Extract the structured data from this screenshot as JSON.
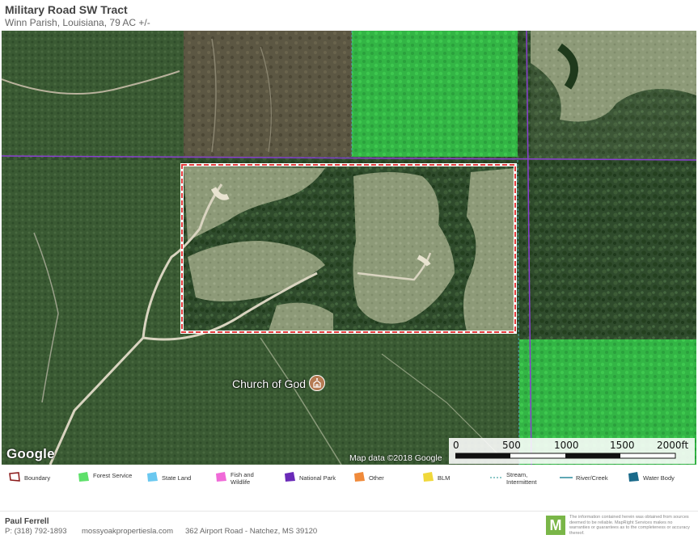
{
  "header": {
    "title": "Military Road SW Tract",
    "subtitle": "Winn Parish, Louisiana, 79 AC +/-"
  },
  "map": {
    "type": "satellite",
    "poi": {
      "label": "Church of God",
      "icon": "church-icon"
    },
    "google_logo": "Google",
    "attribution": "Map data ©2018 Google",
    "scale": {
      "ticks": [
        "0",
        "500",
        "1000",
        "1500",
        "2000ft"
      ]
    },
    "colors": {
      "boundary": "#e23b3b",
      "forest_service": "#39d44a",
      "grid_line": "#8a3fd1"
    }
  },
  "legend": [
    {
      "label": "Boundary",
      "icon": "boundary-outline-icon",
      "color": "#8b1a1a"
    },
    {
      "label": "Forest Service",
      "icon": "polygon-icon",
      "color": "#5ee06a"
    },
    {
      "label": "State Land",
      "icon": "polygon-icon",
      "color": "#6ac8f0"
    },
    {
      "label": "Fish and Wildlife",
      "icon": "polygon-icon",
      "color": "#f06ad8"
    },
    {
      "label": "National Park",
      "icon": "polygon-icon",
      "color": "#6a2ab8"
    },
    {
      "label": "Other",
      "icon": "polygon-icon",
      "color": "#f08a3a"
    },
    {
      "label": "BLM",
      "icon": "polygon-icon",
      "color": "#f0d83a"
    },
    {
      "label": "Stream, Intermittent",
      "icon": "dashed-line-icon",
      "color": "#4aa8a8"
    },
    {
      "label": "River/Creek",
      "icon": "line-icon",
      "color": "#2a8a9a"
    },
    {
      "label": "Water Body",
      "icon": "polygon-icon",
      "color": "#1a6a8a"
    }
  ],
  "footer": {
    "name": "Paul Ferrell",
    "phone": "P: (318) 792-1893",
    "website": "mossyoakpropertiesla.com",
    "address": "362 Airport Road - Natchez, MS 39120",
    "logo_letter": "M",
    "disclaimer": "The information contained herein was obtained from sources deemed to be reliable. MapRight Services makes no warranties or guarantees as to the completeness or accuracy thereof."
  }
}
